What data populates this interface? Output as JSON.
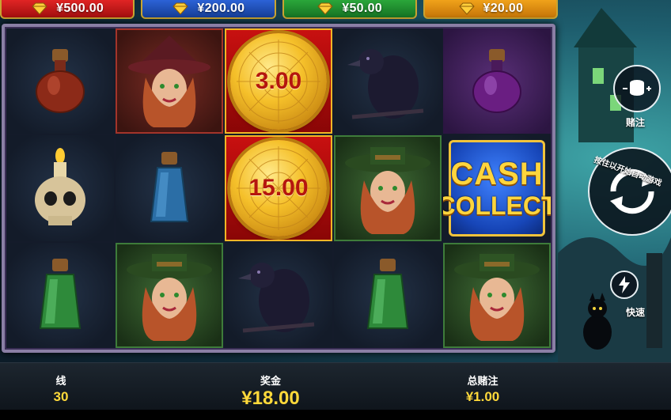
{
  "jackpots": [
    {
      "amount": "¥500.00",
      "color": "#c71a1a"
    },
    {
      "amount": "¥200.00",
      "color": "#1f4fb3"
    },
    {
      "amount": "¥50.00",
      "color": "#1f8a2c"
    },
    {
      "amount": "¥20.00",
      "color": "#d98a0e"
    }
  ],
  "reels": {
    "coins": [
      "3.00",
      "15.00"
    ],
    "cash_collect": {
      "line1": "CASH",
      "line2": "COLLECT"
    },
    "symbols": [
      [
        "potion-red",
        "skull-candle",
        "potion-green"
      ],
      [
        "witch-red",
        "potion-blue",
        "witch-green"
      ],
      [
        "coin",
        "coin",
        "raven"
      ],
      [
        "raven",
        "witch-green",
        "potion-green"
      ],
      [
        "potion-purple",
        "cash-collect",
        "witch-green"
      ]
    ]
  },
  "side": {
    "bet_label": "赌注",
    "autoplay_label": "按住以开始自动游戏",
    "turbo_label": "快速"
  },
  "bottom": {
    "lines_label": "线",
    "lines_value": "30",
    "win_label": "奖金",
    "win_value": "¥18.00",
    "total_bet_label": "总赌注",
    "total_bet_value": "¥1.00"
  }
}
